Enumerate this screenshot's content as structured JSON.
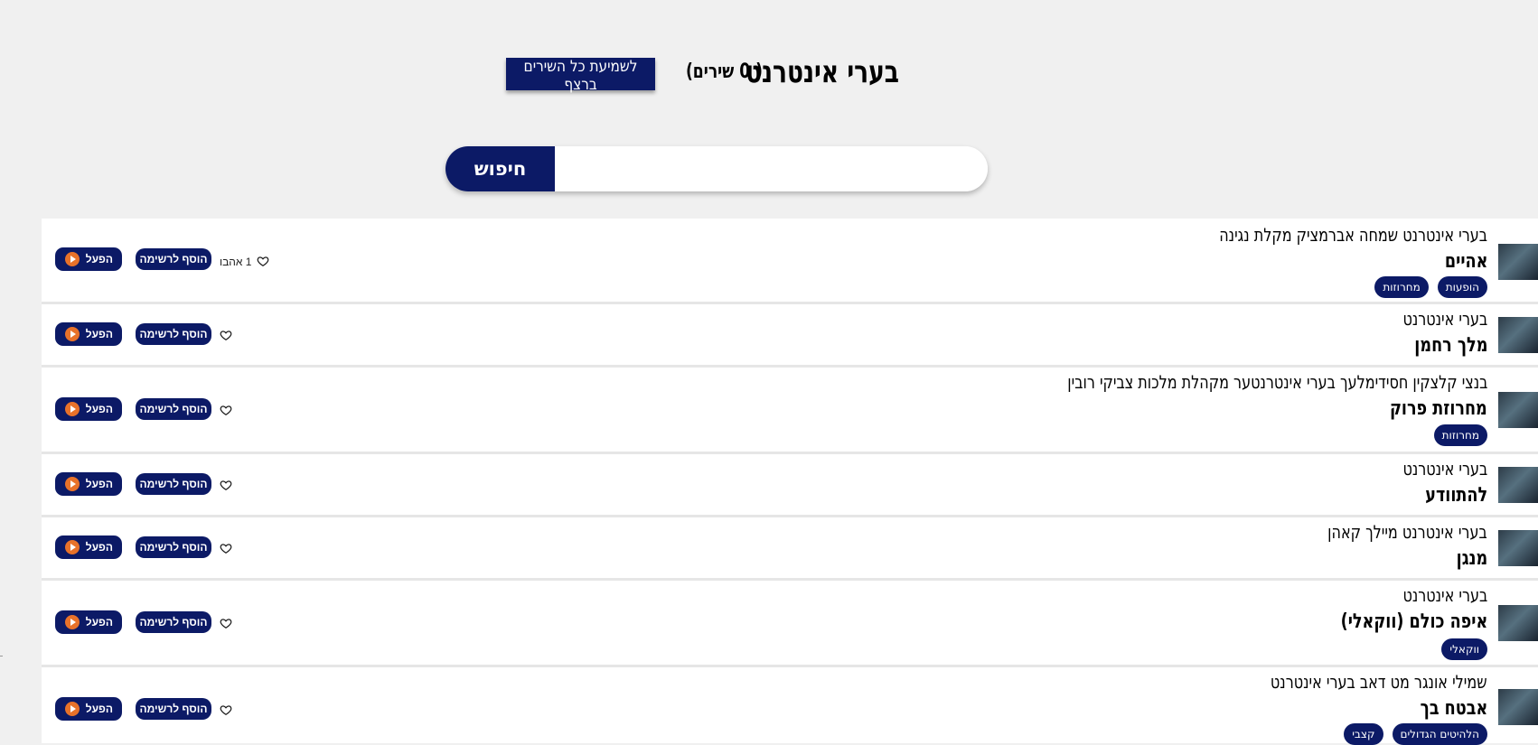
{
  "header": {
    "title": "בערי אינטרנט",
    "count_text": "( 0 שירים)",
    "play_all_label": "לשמיעת כל השירים ברצף"
  },
  "search": {
    "button_label": "חיפוש",
    "placeholder": "",
    "value": ""
  },
  "actions": {
    "play_label": "הפעל",
    "add_label": "הוסף לרשימה"
  },
  "colors": {
    "navy": "#0c1a66",
    "orange": "#e8722a",
    "background": "#f0f0f0"
  },
  "songs": [
    {
      "artist": "בערי אינטרנט שמחה אברמציק מקלת נגינה",
      "title": "אהיים",
      "tags": [
        "הופעות",
        "מחרוזות"
      ],
      "likes": "1 אהבו"
    },
    {
      "artist": "בערי אינטרנט",
      "title": "מלך רחמן",
      "tags": [],
      "likes": ""
    },
    {
      "artist": "בנצי קלצקין חסידימלעך בערי אינטרנטער מקהלת מלכות צביקי רובין",
      "title": "מחרוזת פרוק",
      "tags": [
        "מחרוזות"
      ],
      "likes": ""
    },
    {
      "artist": "בערי אינטרנט",
      "title": "להתוודע",
      "tags": [],
      "likes": ""
    },
    {
      "artist": "בערי אינטרנט מיילך קאהן",
      "title": "מנגן",
      "tags": [],
      "likes": ""
    },
    {
      "artist": "בערי אינטרנט",
      "title": "איפה כולם (ווקאלי)",
      "tags": [
        "ווקאלי"
      ],
      "likes": ""
    },
    {
      "artist": "שמילי אונגר מט דאב בערי אינטרנט",
      "title": "אבטח בך",
      "tags": [
        "הלהיטים הגדולים",
        "קצבי"
      ],
      "likes": ""
    }
  ]
}
